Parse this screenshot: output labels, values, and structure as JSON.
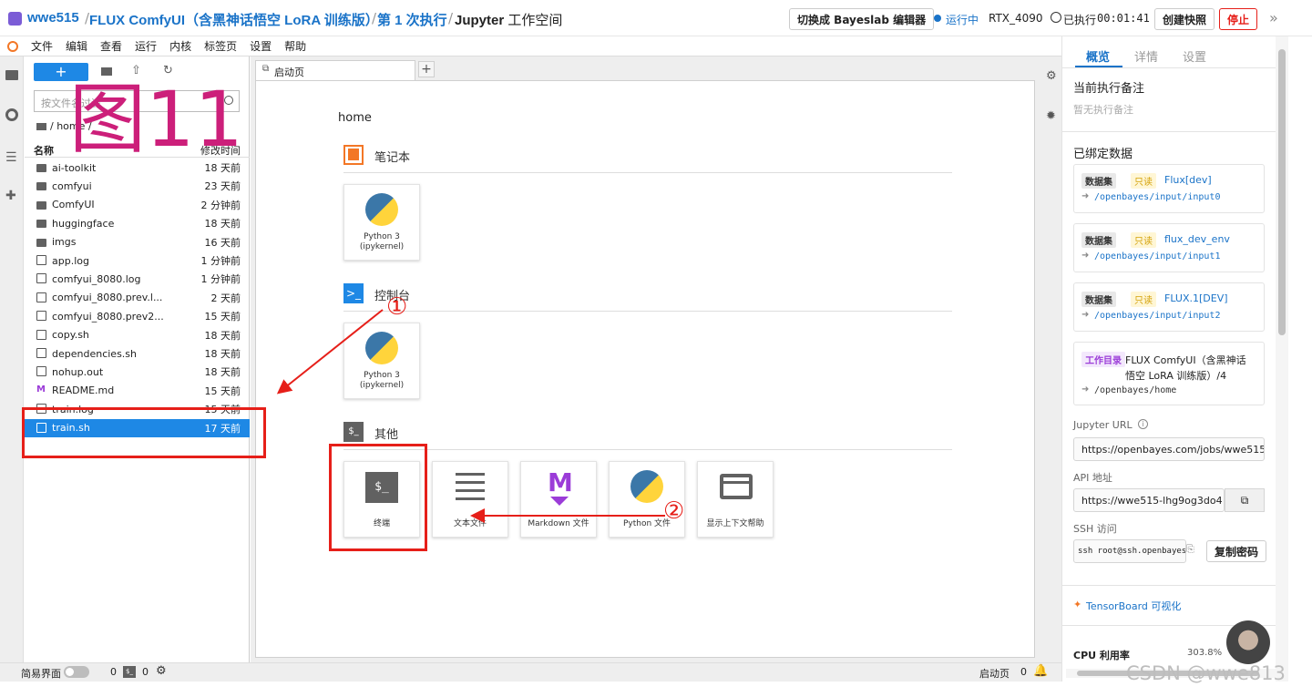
{
  "topbar": {
    "user": "wwe515",
    "project": "FLUX ComfyUI（含黑神话悟空 LoRA 训练版）",
    "run": "第 1 次执行",
    "workspace_bold": "Jupyter",
    "workspace_rest": " 工作空间",
    "switch_editor": "切换成 Bayeslab 编辑器",
    "status": "运行中",
    "gpu": "RTX_4090",
    "elapsed_label": "已执行",
    "elapsed": "00:01:41",
    "snapshot": "创建快照",
    "stop": "停止"
  },
  "menu": [
    "文件",
    "编辑",
    "查看",
    "运行",
    "内核",
    "标签页",
    "设置",
    "帮助"
  ],
  "filebrowser": {
    "search_placeholder": "按文件名过滤",
    "breadcrumb": "/ home /",
    "col_name": "名称",
    "col_time": "修改时间",
    "files": [
      {
        "name": "ai-toolkit",
        "time": "18 天前",
        "type": "folder"
      },
      {
        "name": "comfyui",
        "time": "23 天前",
        "type": "folder"
      },
      {
        "name": "ComfyUI",
        "time": "2 分钟前",
        "type": "folder"
      },
      {
        "name": "huggingface",
        "time": "18 天前",
        "type": "folder"
      },
      {
        "name": "imgs",
        "time": "16 天前",
        "type": "folder"
      },
      {
        "name": "app.log",
        "time": "1 分钟前",
        "type": "file"
      },
      {
        "name": "comfyui_8080.log",
        "time": "1 分钟前",
        "type": "file"
      },
      {
        "name": "comfyui_8080.prev.l...",
        "time": "2 天前",
        "type": "file"
      },
      {
        "name": "comfyui_8080.prev2...",
        "time": "15 天前",
        "type": "file"
      },
      {
        "name": "copy.sh",
        "time": "18 天前",
        "type": "file"
      },
      {
        "name": "dependencies.sh",
        "time": "18 天前",
        "type": "file"
      },
      {
        "name": "nohup.out",
        "time": "18 天前",
        "type": "file"
      },
      {
        "name": "README.md",
        "time": "15 天前",
        "type": "md"
      },
      {
        "name": "train.log",
        "time": "15 天前",
        "type": "file"
      },
      {
        "name": "train.sh",
        "time": "17 天前",
        "type": "file"
      }
    ]
  },
  "tab": {
    "label": "启动页"
  },
  "launcher": {
    "cwd": "home",
    "notebook_section": "笔记本",
    "console_section": "控制台",
    "other_section": "其他",
    "kernel_label_1": "Python 3",
    "kernel_label_2": "(ipykernel)",
    "other_items": [
      "终端",
      "文本文件",
      "Markdown 文件",
      "Python 文件",
      "显示上下文帮助"
    ]
  },
  "rightpanel": {
    "tabs": [
      "概览",
      "详情",
      "设置"
    ],
    "note_title": "当前执行备注",
    "note_empty": "暂无执行备注",
    "bound_title": "已绑定数据",
    "datasets": [
      {
        "tag": "数据集",
        "ro": "只读",
        "name": "Flux[dev]",
        "path": "/openbayes/input/input0"
      },
      {
        "tag": "数据集",
        "ro": "只读",
        "name": "flux_dev_env",
        "path": "/openbayes/input/input1"
      },
      {
        "tag": "数据集",
        "ro": "只读",
        "name": "FLUX.1[DEV]",
        "path": "/openbayes/input/input2"
      }
    ],
    "workdir": {
      "tag": "工作目录",
      "name_1": "FLUX ComfyUI（含黑神话",
      "name_2": "悟空 LoRA 训练版）/4",
      "path": "/openbayes/home"
    },
    "jupyter_url_label": "Jupyter URL",
    "jupyter_url": "https://openbayes.com/jobs/wwe515",
    "api_label": "API 地址",
    "api_url": "https://wwe515-lhg9og3do4",
    "ssh_label": "SSH 访问",
    "ssh_value": "ssh root@ssh.openbayes",
    "copy_pwd": "复制密码",
    "tensorboard": "TensorBoard 可视化",
    "cpu_label": "CPU 利用率",
    "cpu_value": "303.8%"
  },
  "statusbar": {
    "simple_mode": "简易界面",
    "count_a": "0",
    "count_b": "0",
    "launcher_label": "启动页",
    "count_c": "0"
  },
  "annotations": {
    "figure_label": "图11",
    "step1": "①",
    "step2": "②",
    "watermark": "CSDN @wwe813"
  },
  "colors": {
    "accent": "#1a73c8",
    "annotation": "#e61f19",
    "selected": "#1e88e5",
    "figure": "#cc1f7a"
  }
}
